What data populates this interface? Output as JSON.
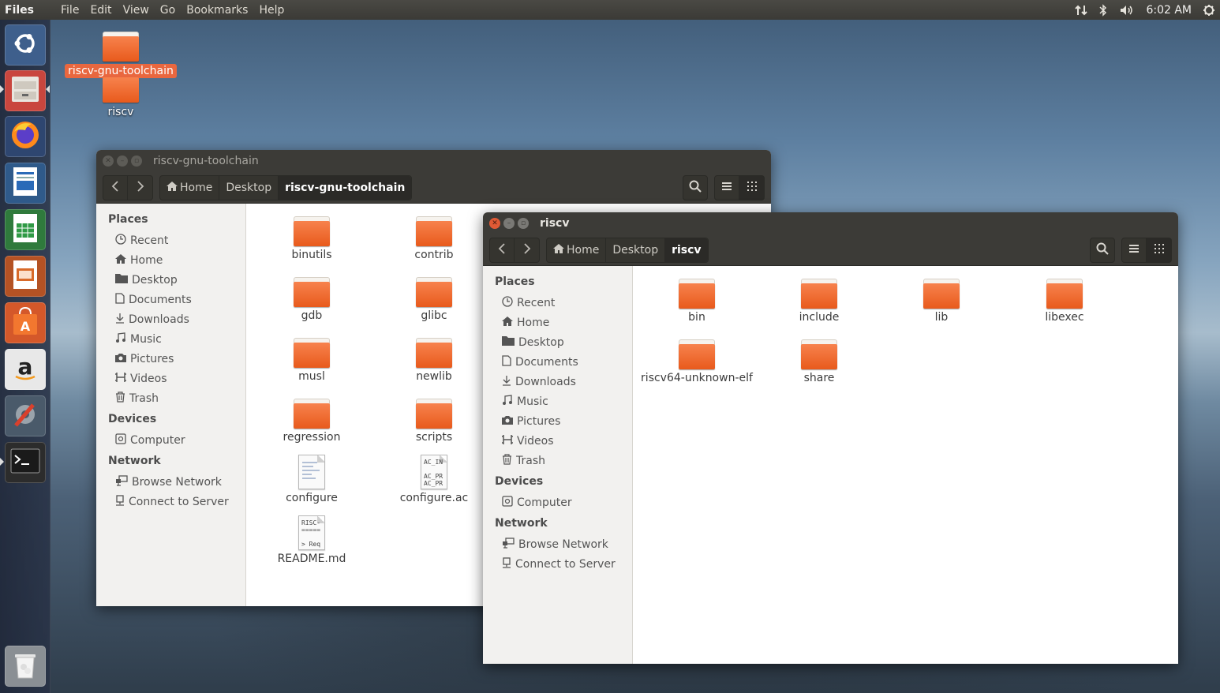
{
  "top_panel": {
    "app_name": "Files",
    "menus": [
      "File",
      "Edit",
      "View",
      "Go",
      "Bookmarks",
      "Help"
    ],
    "clock": "6:02 AM"
  },
  "launcher": {
    "items": [
      "ubuntu-dash",
      "files",
      "firefox",
      "libreoffice-writer",
      "libreoffice-calc",
      "libreoffice-impress",
      "ubuntu-software",
      "amazon",
      "system-settings",
      "terminal",
      "trash"
    ]
  },
  "desktop": {
    "icons": [
      {
        "label": "riscv-gnu-toolchain",
        "selected": true
      },
      {
        "label": "riscv",
        "selected": false
      }
    ]
  },
  "window_toolchain": {
    "title": "riscv-gnu-toolchain",
    "breadcrumbs": [
      "Home",
      "Desktop",
      "riscv-gnu-toolchain"
    ],
    "files": [
      {
        "name": "binutils",
        "kind": "folder"
      },
      {
        "name": "contrib",
        "kind": "folder"
      },
      {
        "name": "gdb",
        "kind": "folder"
      },
      {
        "name": "glibc",
        "kind": "folder"
      },
      {
        "name": "musl",
        "kind": "folder"
      },
      {
        "name": "newlib",
        "kind": "folder"
      },
      {
        "name": "regression",
        "kind": "folder"
      },
      {
        "name": "scripts",
        "kind": "folder"
      },
      {
        "name": "configure",
        "kind": "script"
      },
      {
        "name": "configure.ac",
        "kind": "text",
        "preview": "AC_IN\n\nAC_PR\nAC_PR"
      },
      {
        "name": "README.md",
        "kind": "text",
        "preview": "RISC-\n=====\n\n> Req"
      }
    ]
  },
  "window_riscv": {
    "title": "riscv",
    "breadcrumbs": [
      "Home",
      "Desktop",
      "riscv"
    ],
    "files": [
      {
        "name": "bin",
        "kind": "folder"
      },
      {
        "name": "include",
        "kind": "folder"
      },
      {
        "name": "lib",
        "kind": "folder"
      },
      {
        "name": "libexec",
        "kind": "folder"
      },
      {
        "name": "riscv64-unknown-elf",
        "kind": "folder"
      },
      {
        "name": "share",
        "kind": "folder"
      }
    ]
  },
  "sidebar": {
    "places_heading": "Places",
    "places": [
      {
        "label": "Recent",
        "icon": "clock-icon"
      },
      {
        "label": "Home",
        "icon": "home-icon"
      },
      {
        "label": "Desktop",
        "icon": "folder-icon"
      },
      {
        "label": "Documents",
        "icon": "document-icon"
      },
      {
        "label": "Downloads",
        "icon": "download-icon"
      },
      {
        "label": "Music",
        "icon": "music-icon"
      },
      {
        "label": "Pictures",
        "icon": "camera-icon"
      },
      {
        "label": "Videos",
        "icon": "film-icon"
      },
      {
        "label": "Trash",
        "icon": "trash-icon"
      }
    ],
    "devices_heading": "Devices",
    "devices": [
      {
        "label": "Computer",
        "icon": "drive-icon"
      }
    ],
    "network_heading": "Network",
    "network": [
      {
        "label": "Browse Network",
        "icon": "network-icon"
      },
      {
        "label": "Connect to Server",
        "icon": "server-icon"
      }
    ]
  },
  "colors": {
    "accent": "#e9673f",
    "folder": "#f0692e",
    "titlebar": "#3c3b37",
    "sidebar_bg": "#f2f1ef"
  }
}
